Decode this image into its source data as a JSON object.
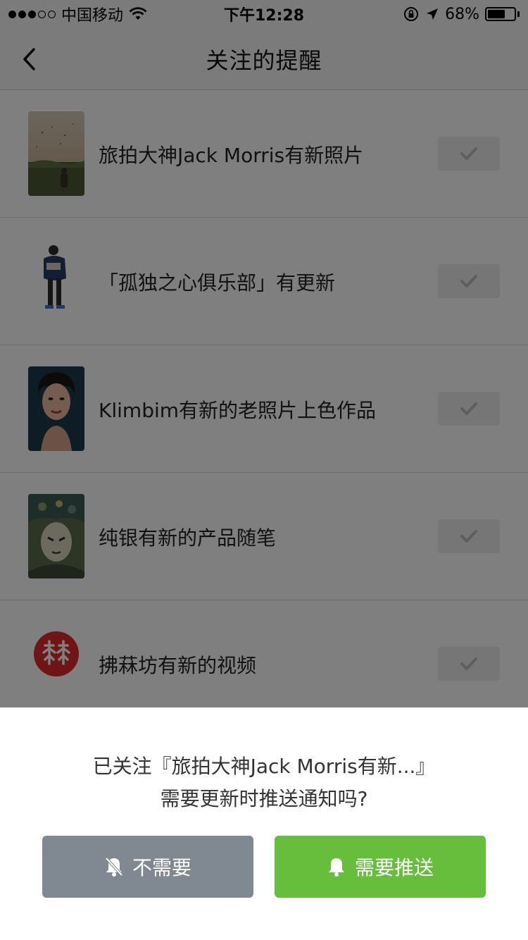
{
  "status_bar": {
    "carrier": "中国移动",
    "time": "下午12:28",
    "battery": "68%",
    "battery_level": 0.68
  },
  "nav": {
    "title": "关注的提醒"
  },
  "items": [
    {
      "text": "旅拍大神Jack Morris有新照片",
      "checked": true,
      "thumb_icon": "landscape-photo"
    },
    {
      "text": "「孤独之心俱乐部」有更新",
      "checked": true,
      "thumb_icon": "illustrated-person"
    },
    {
      "text": "Klimbim有新的老照片上色作品",
      "checked": true,
      "thumb_icon": "portrait-photo"
    },
    {
      "text": "纯银有新的产品随笔",
      "checked": true,
      "thumb_icon": "ornate-illustration"
    },
    {
      "text": "拂菻坊有新的视频",
      "checked": true,
      "thumb_icon": "red-circle-logo"
    }
  ],
  "sheet": {
    "line1": "已关注『旅拍大神Jack Morris有新...』",
    "line2": "需要更新时推送通知吗?",
    "no_label": "不需要",
    "yes_label": "需要推送",
    "no_icon": "bell-off-icon",
    "yes_icon": "bell-icon"
  },
  "colors": {
    "accent_green": "#67bd3c",
    "neutral_button": "#808891",
    "overlay": "rgba(0,0,0,0.5)"
  }
}
